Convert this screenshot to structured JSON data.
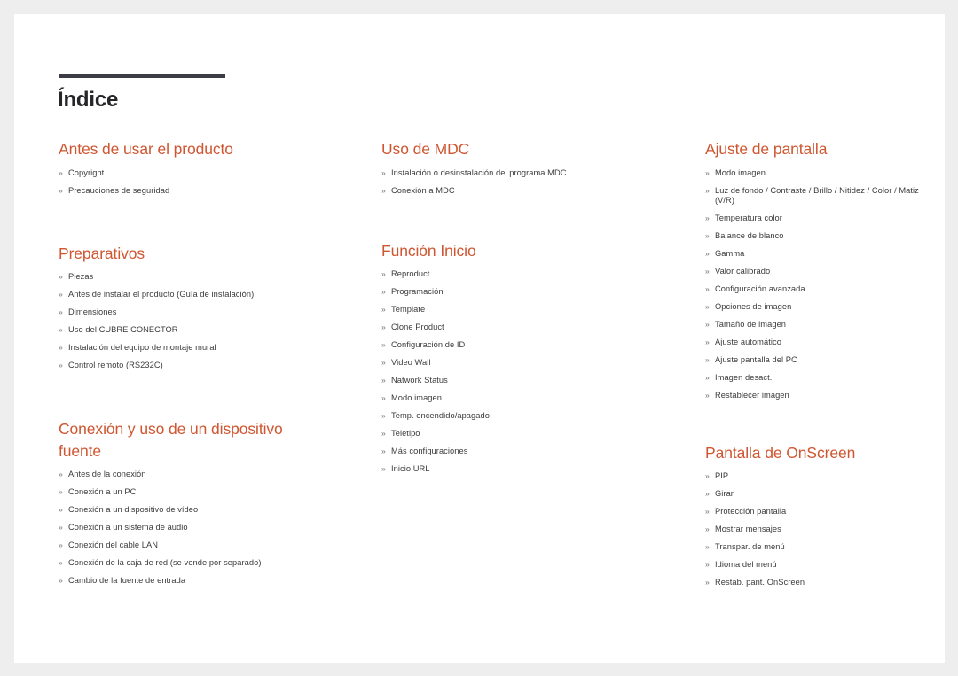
{
  "document": {
    "title": "Índice",
    "accent_color": "#cf5631",
    "rule_color": "#3c3c45",
    "text_color": "#3b3b3b",
    "background_color": "#eeeeee",
    "card_color": "#ffffff",
    "bullet_glyph": "»"
  },
  "columns": [
    {
      "id": "column-1",
      "sections": [
        {
          "heading": "Antes de usar el producto",
          "items": [
            "Copyright",
            "Precauciones de seguridad"
          ]
        },
        {
          "heading": "Preparativos",
          "items": [
            "Piezas",
            "Antes de instalar el producto (Guía de instalación)",
            "Dimensiones",
            "Uso del CUBRE CONECTOR",
            "Instalación del equipo de montaje mural",
            "Control remoto (RS232C)"
          ]
        },
        {
          "heading": "Conexión y uso de un dispositivo fuente",
          "items": [
            "Antes de la conexión",
            "Conexión a un PC",
            "Conexión a un dispositivo de vídeo",
            "Conexión a un sistema de audio",
            "Conexión del cable LAN",
            "Conexión de la caja de red (se vende por separado)",
            "Cambio de la fuente de entrada"
          ]
        }
      ]
    },
    {
      "id": "column-2",
      "sections": [
        {
          "heading": "Uso de MDC",
          "items": [
            "Instalación o desinstalación del programa MDC",
            "Conexión a MDC"
          ]
        },
        {
          "heading": "Función Inicio",
          "items": [
            "Reproduct.",
            "Programación",
            "Template",
            "Clone Product",
            "Configuración de ID",
            "Video Wall",
            "Natwork Status",
            "Modo imagen",
            "Temp. encendido/apagado",
            "Teletipo",
            "Más configuraciones",
            "Inicio URL"
          ]
        }
      ]
    },
    {
      "id": "column-3",
      "sections": [
        {
          "heading": "Ajuste de pantalla",
          "items": [
            "Modo imagen",
            "Luz de fondo / Contraste / Brillo / Nitidez / Color / Matiz (V/R)",
            "Temperatura color",
            "Balance de blanco",
            "Gamma",
            "Valor calibrado",
            "Configuración avanzada",
            "Opciones de imagen",
            "Tamaño de imagen",
            "Ajuste automático",
            "Ajuste pantalla del PC",
            "Imagen desact.",
            "Restablecer imagen"
          ]
        },
        {
          "heading": "Pantalla de OnScreen",
          "items": [
            "PIP",
            "Girar",
            "Protección pantalla",
            "Mostrar mensajes",
            "Transpar. de menú",
            "Idioma del menú",
            "Restab. pant. OnScreen"
          ]
        }
      ]
    }
  ]
}
